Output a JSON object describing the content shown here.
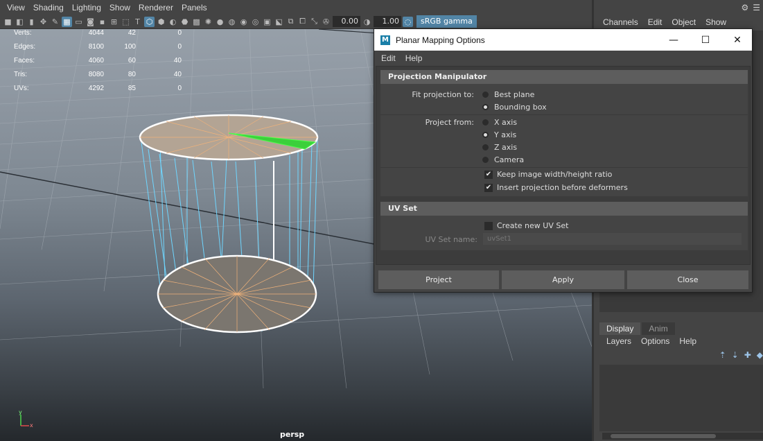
{
  "viewport": {
    "menus": [
      "View",
      "Shading",
      "Lighting",
      "Show",
      "Renderer",
      "Panels"
    ],
    "toolbar": {
      "exposure_value": "0.00",
      "gamma_value": "1.00",
      "color_space": "sRGB gamma"
    },
    "hud": {
      "rows": [
        {
          "label": "Verts:",
          "v1": "4044",
          "v2": "42",
          "v3": "0"
        },
        {
          "label": "Edges:",
          "v1": "8100",
          "v2": "100",
          "v3": "0"
        },
        {
          "label": "Faces:",
          "v1": "4060",
          "v2": "60",
          "v3": "40"
        },
        {
          "label": "Tris:",
          "v1": "8080",
          "v2": "80",
          "v3": "40"
        },
        {
          "label": "UVs:",
          "v1": "4292",
          "v2": "85",
          "v3": "0"
        }
      ]
    },
    "camera_label": "persp",
    "axis": {
      "y": "y",
      "x": "x"
    }
  },
  "right_panel": {
    "menus": [
      "Channels",
      "Edit",
      "Object",
      "Show"
    ],
    "layer_tabs": [
      "Display",
      "Anim"
    ],
    "layer_menus": [
      "Layers",
      "Options",
      "Help"
    ]
  },
  "dialog": {
    "logo": "M",
    "title": "Planar Mapping Options",
    "menus": [
      "Edit",
      "Help"
    ],
    "projection_manipulator": {
      "header": "Projection Manipulator",
      "fit_label": "Fit projection to:",
      "fit_options": [
        "Best plane",
        "Bounding box"
      ],
      "fit_selected": 1,
      "project_from_label": "Project from:",
      "project_from_options": [
        "X axis",
        "Y axis",
        "Z axis",
        "Camera"
      ],
      "project_from_selected": 1,
      "keep_ratio_label": "Keep image width/height ratio",
      "keep_ratio_checked": true,
      "insert_before_label": "Insert projection before deformers",
      "insert_before_checked": true
    },
    "uv_set": {
      "header": "UV Set",
      "create_new_label": "Create new UV Set",
      "create_new_checked": false,
      "name_label": "UV Set name:",
      "name_value": "uvSet1"
    },
    "buttons": {
      "project": "Project",
      "apply": "Apply",
      "close": "Close"
    }
  }
}
